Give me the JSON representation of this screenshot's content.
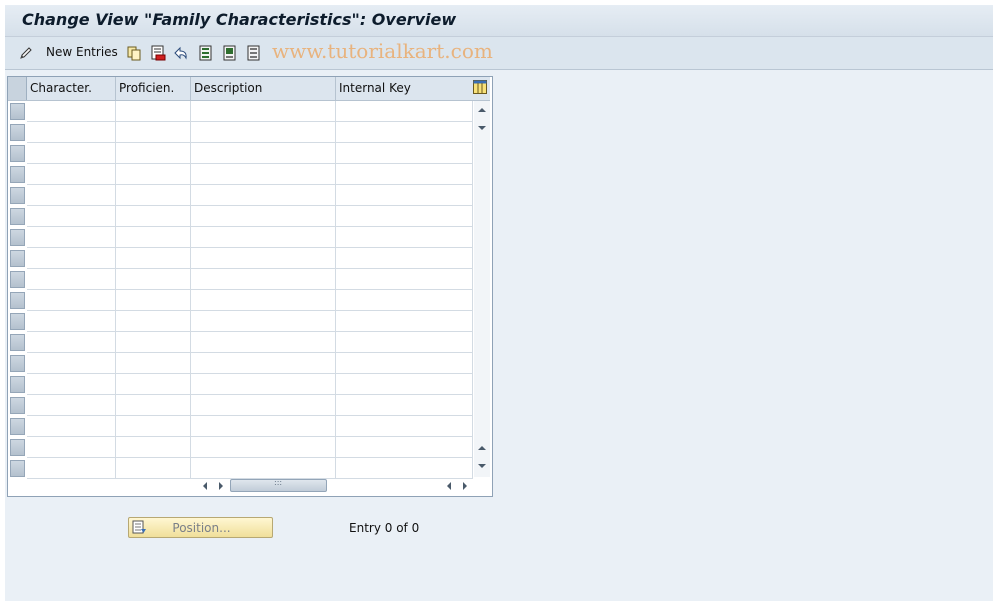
{
  "window": {
    "title": "Change View \"Family Characteristics\": Overview"
  },
  "toolbar": {
    "new_entries_label": "New Entries",
    "icons": [
      "edit-pencil-icon",
      "copy-icon",
      "delete-icon",
      "undo-icon",
      "select-all-icon",
      "select-block-icon",
      "deselect-all-icon"
    ]
  },
  "watermark": "www.tutorialkart.com",
  "table": {
    "columns": [
      "Character.",
      "Proficien.",
      "Description",
      "Internal Key"
    ],
    "rows": []
  },
  "footer": {
    "position_button_label": "Position...",
    "entry_info": "Entry 0 of 0"
  },
  "colors": {
    "title_text": "#0d1c2c",
    "watermark": "#e8b37e",
    "position_button": "#f4e6a8",
    "background": "#eaf0f6"
  }
}
